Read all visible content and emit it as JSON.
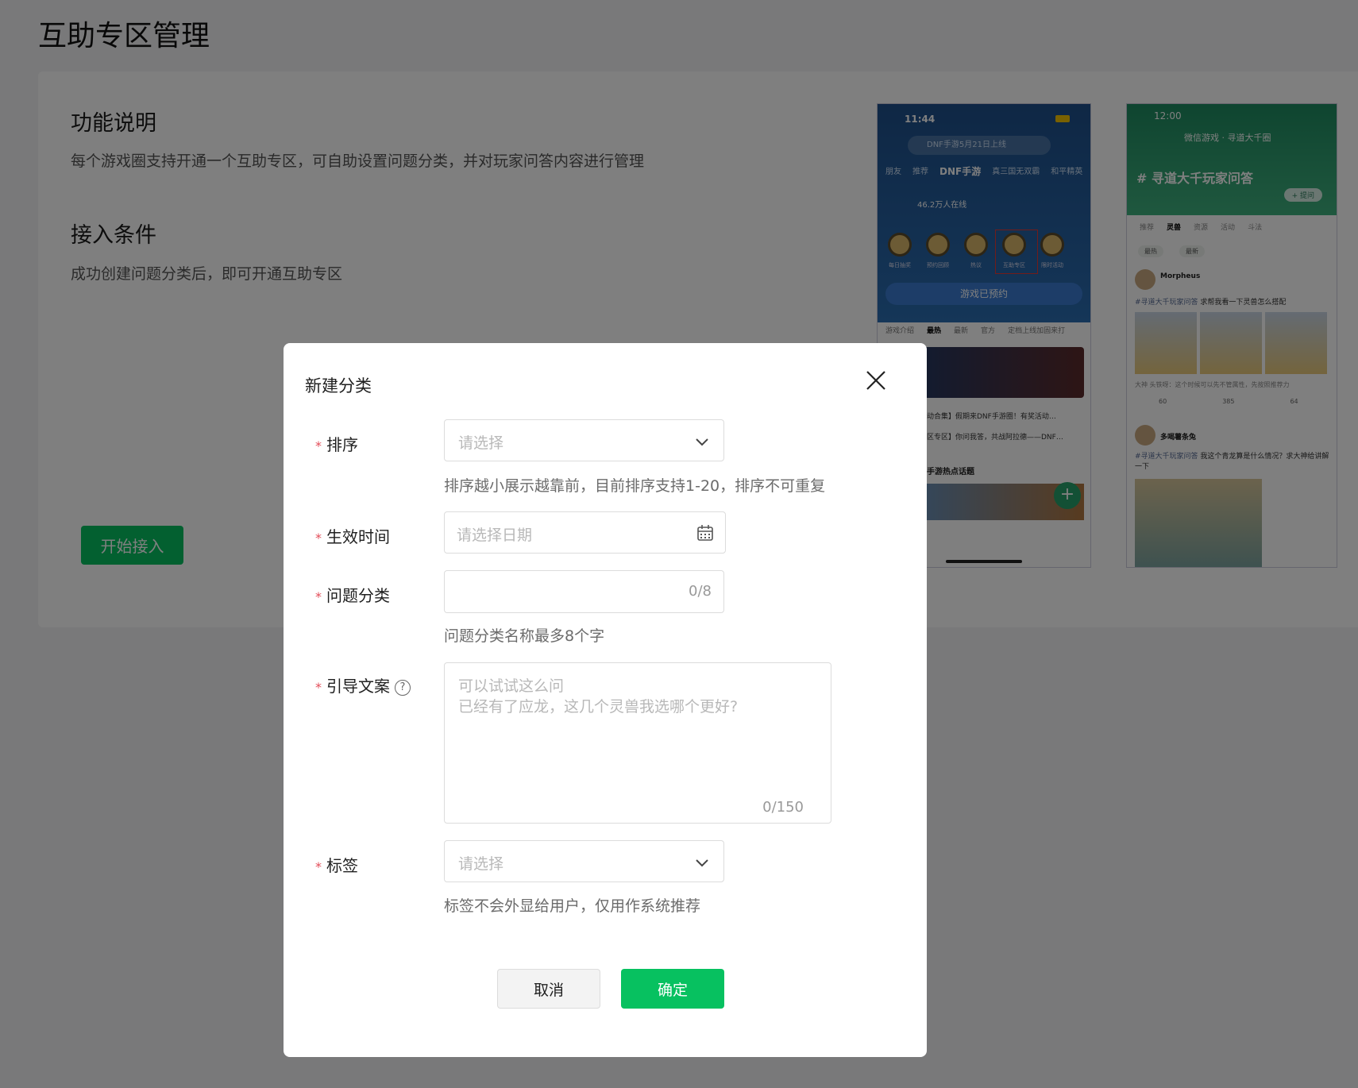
{
  "page": {
    "title": "互助专区管理",
    "feature_title": "功能说明",
    "feature_desc": "每个游戏圈支持开通一个互助专区，可自助设置问题分类，并对玩家问答内容进行管理",
    "condition_title": "接入条件",
    "condition_desc": "成功创建问题分类后，即可开通互助专区",
    "start_button": "开始接入"
  },
  "preview1": {
    "time": "11:44",
    "search": "DNF手游5月21日上线",
    "tabs": [
      "朋友",
      "推荐",
      "DNF手游",
      "真三国无双霸",
      "和平精英"
    ],
    "online": "46.2万人在线",
    "icons": [
      "每日抽奖",
      "预约回顾",
      "热议",
      "互助专区",
      "限时活动"
    ],
    "reserve": "游戏已预约",
    "subtabs": [
      "游戏介绍",
      "最热",
      "最新",
      "官方",
      "定档上线加固来打"
    ],
    "news1": "动合集】假期来DNF手游圈！有奖活动…",
    "news2": "区专区】你问我答，共战阿拉德——DNF…",
    "hot": "手游热点话题",
    "plus": "+"
  },
  "preview2": {
    "time": "12:00",
    "nav": "微信游戏 · 寻道大千圈",
    "heading": "# 寻道大千玩家问答",
    "ask": "+ 提问",
    "tabs": [
      "推荐",
      "灵兽",
      "资源",
      "活动",
      "斗法"
    ],
    "pills": [
      "最热",
      "最新"
    ],
    "user1": "Morpheus",
    "post1_tag": "#寻道大千玩家问答",
    "post1": "求帮我看一下灵兽怎么搭配",
    "reply": "大神 头铁呀：这个时候可以先不管属性，先按照推荐力",
    "counts": [
      "60",
      "385",
      "64"
    ],
    "user2": "多喝薯条兔",
    "post2_tag": "#寻道大千玩家问答",
    "post2": "我这个青龙算是什么情况？求大神给讲解一下"
  },
  "modal": {
    "title": "新建分类",
    "sort_label": "排序",
    "sort_placeholder": "请选择",
    "sort_hint": "排序越小展示越靠前，目前排序支持1-20，排序不可重复",
    "time_label": "生效时间",
    "time_placeholder": "请选择日期",
    "category_label": "问题分类",
    "category_count": "0/8",
    "category_hint": "问题分类名称最多8个字",
    "guide_label": "引导文案",
    "guide_help": "?",
    "guide_placeholder_1": "可以试试这么问",
    "guide_placeholder_2": "已经有了应龙，这几个灵兽我选哪个更好?",
    "guide_count": "0/150",
    "tag_label": "标签",
    "tag_placeholder": "请选择",
    "tag_hint": "标签不会外显给用户，仅用作系统推荐",
    "required_mark": "*",
    "cancel": "取消",
    "ok": "确定"
  },
  "colors": {
    "primary": "#07c160",
    "required": "#e34d59",
    "overlay": "rgba(0,0,0,0.5)"
  }
}
